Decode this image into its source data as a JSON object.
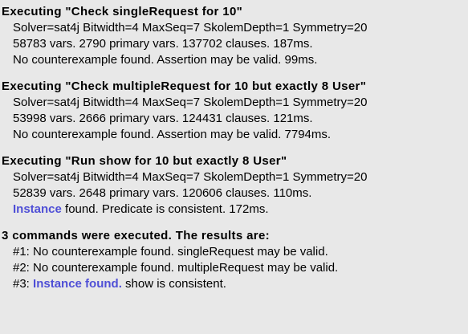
{
  "colors": {
    "background": "#e8e8e8",
    "text": "#000000",
    "link": "#4f4fd6"
  },
  "blocks": [
    {
      "title": "Executing \"Check singleRequest for 10\"",
      "solver": "Solver=sat4j Bitwidth=4 MaxSeq=7 SkolemDepth=1 Symmetry=20",
      "stats": "58783 vars. 2790 primary vars. 137702 clauses. 187ms.",
      "result": "No counterexample found. Assertion may be valid. 99ms."
    },
    {
      "title": "Executing \"Check multipleRequest for 10 but exactly 8 User\"",
      "solver": "Solver=sat4j Bitwidth=4 MaxSeq=7 SkolemDepth=1 Symmetry=20",
      "stats": "53998 vars. 2666 primary vars. 124431 clauses. 121ms.",
      "result": "No counterexample found. Assertion may be valid. 7794ms."
    },
    {
      "title": "Executing \"Run show for 10 but exactly 8 User\"",
      "solver": "Solver=sat4j Bitwidth=4 MaxSeq=7 SkolemDepth=1 Symmetry=20",
      "stats": "52839 vars. 2648 primary vars. 120606 clauses. 110ms.",
      "result_link": "Instance",
      "result_rest": " found. Predicate is consistent. 172ms."
    }
  ],
  "summary": {
    "title": "3 commands were executed. The results are:",
    "item1": "#1: No counterexample found. singleRequest may be valid.",
    "item2": "#2: No counterexample found. multipleRequest may be valid.",
    "item3_prefix": "#3: ",
    "item3_link": "Instance found.",
    "item3_rest": " show is consistent."
  }
}
